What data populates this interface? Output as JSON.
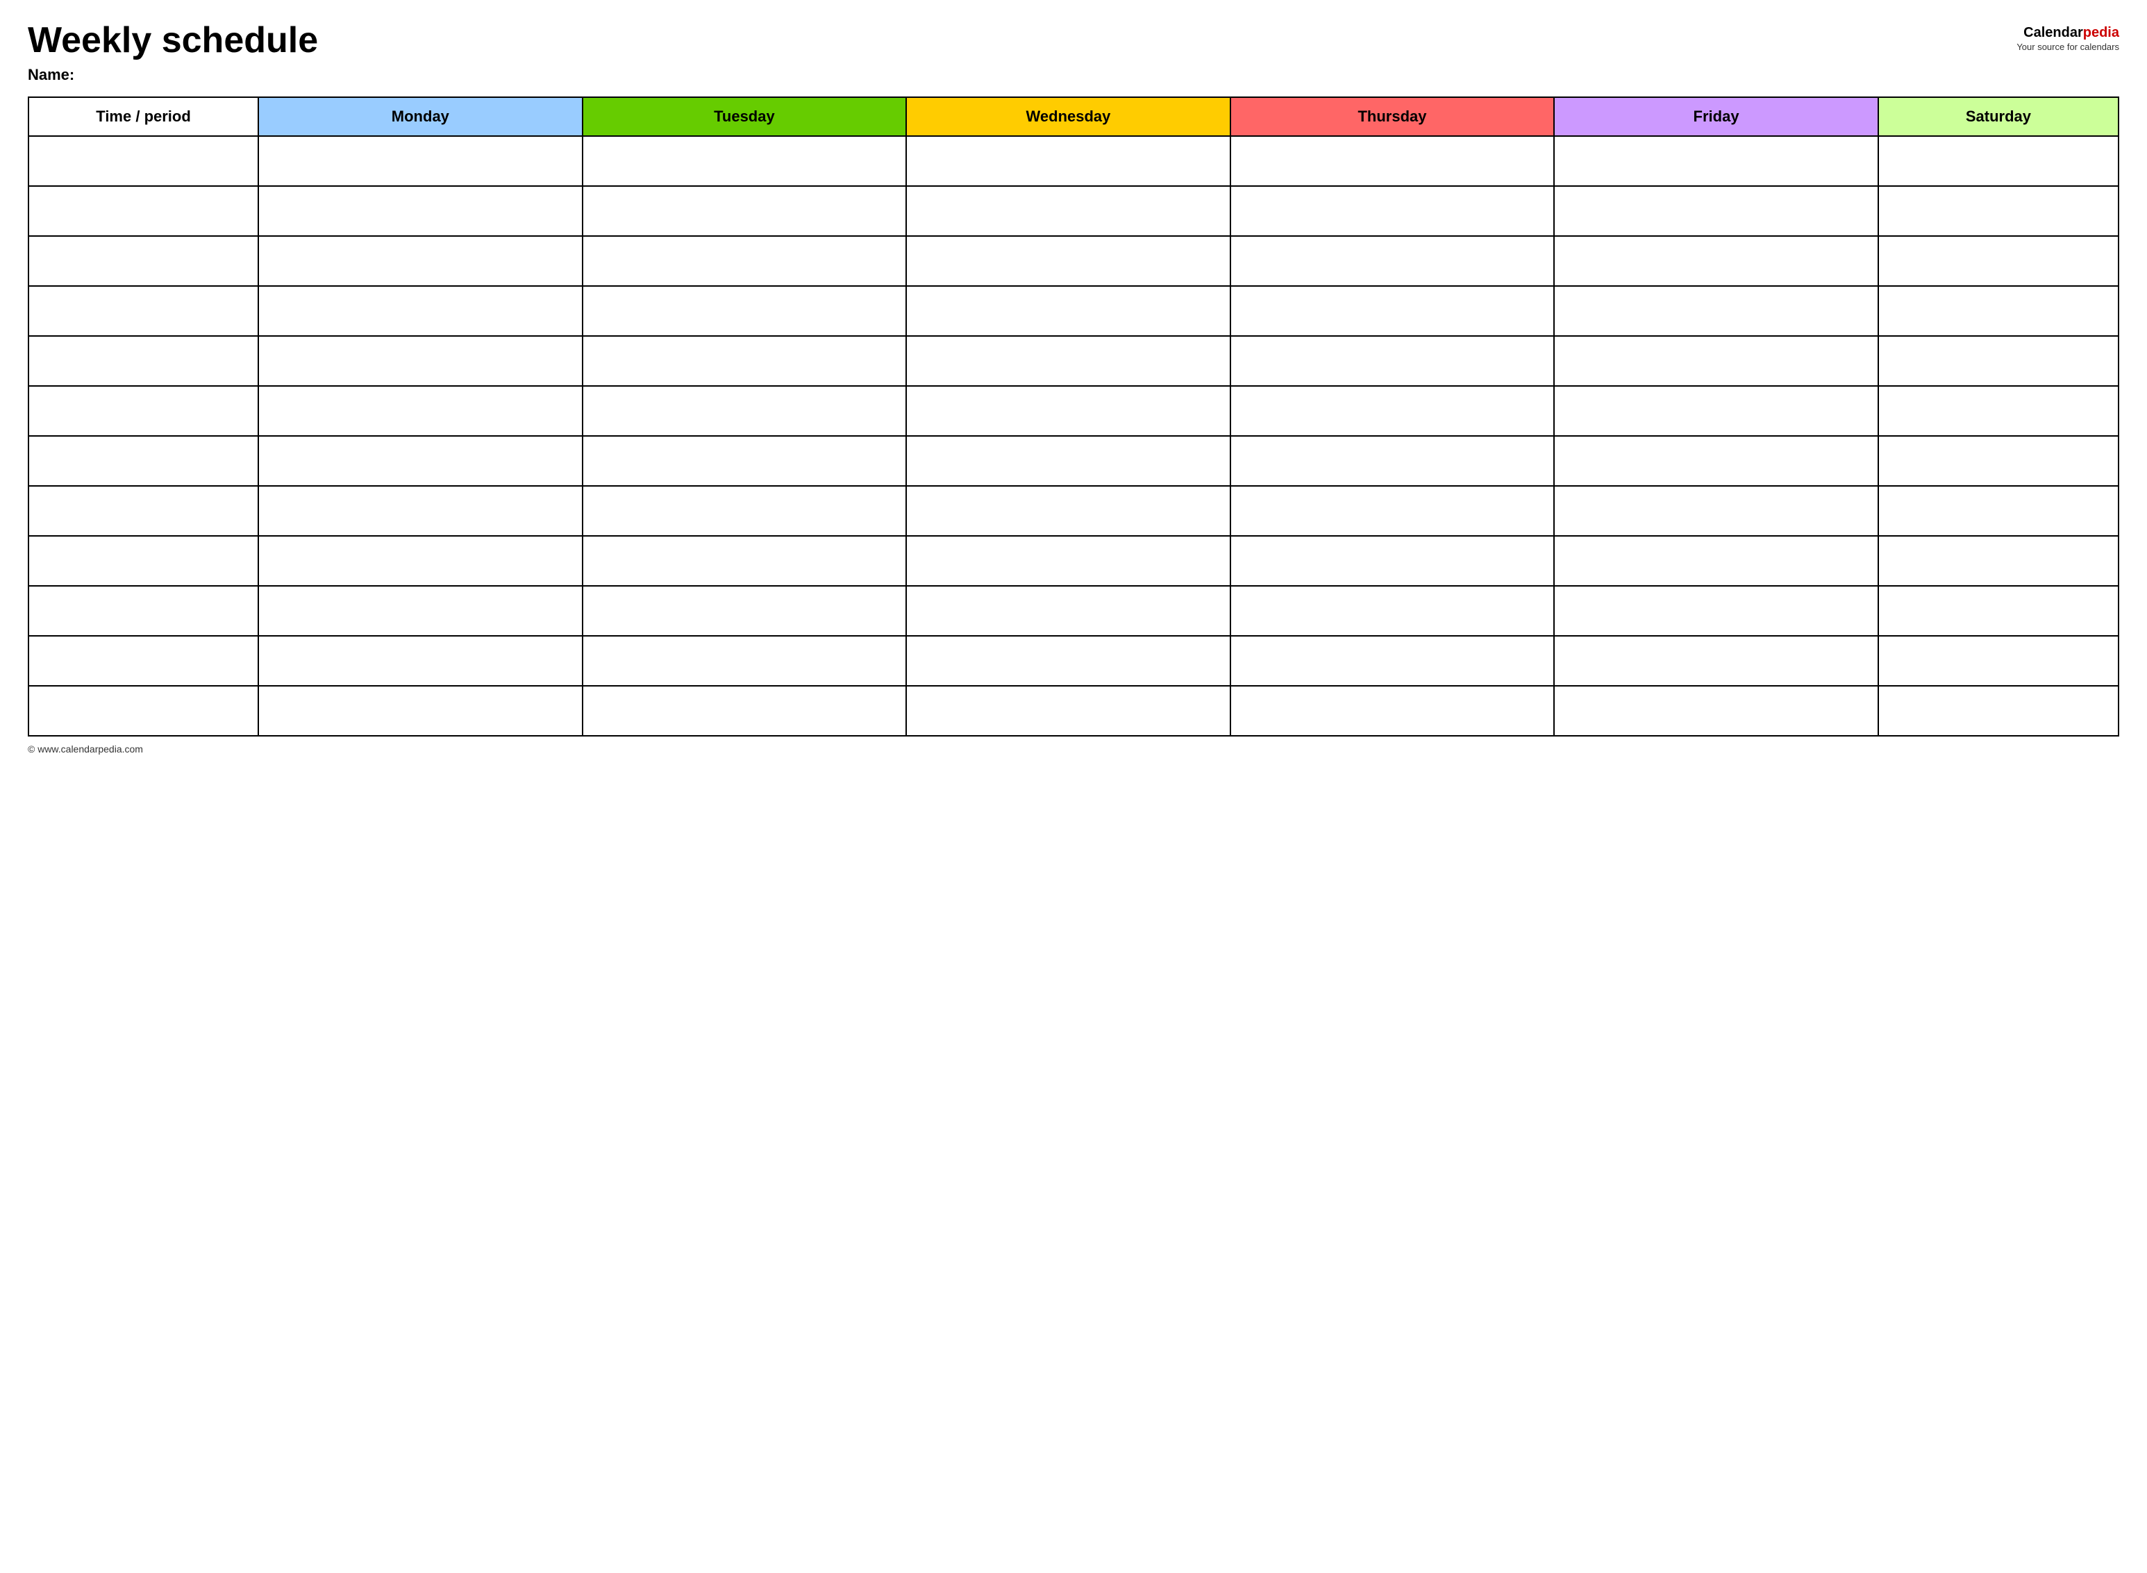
{
  "header": {
    "title": "Weekly schedule",
    "name_label": "Name:",
    "logo_calendar": "Calendar",
    "logo_pedia": "pedia",
    "logo_tagline": "Your source for calendars"
  },
  "table": {
    "columns": [
      {
        "key": "time",
        "label": "Time / period",
        "color": "#ffffff"
      },
      {
        "key": "monday",
        "label": "Monday",
        "color": "#99ccff"
      },
      {
        "key": "tuesday",
        "label": "Tuesday",
        "color": "#66cc00"
      },
      {
        "key": "wednesday",
        "label": "Wednesday",
        "color": "#ffcc00"
      },
      {
        "key": "thursday",
        "label": "Thursday",
        "color": "#ff6666"
      },
      {
        "key": "friday",
        "label": "Friday",
        "color": "#cc99ff"
      },
      {
        "key": "saturday",
        "label": "Saturday",
        "color": "#ccff99"
      }
    ],
    "row_count": 12
  },
  "footer": {
    "url": "© www.calendarpedia.com"
  }
}
